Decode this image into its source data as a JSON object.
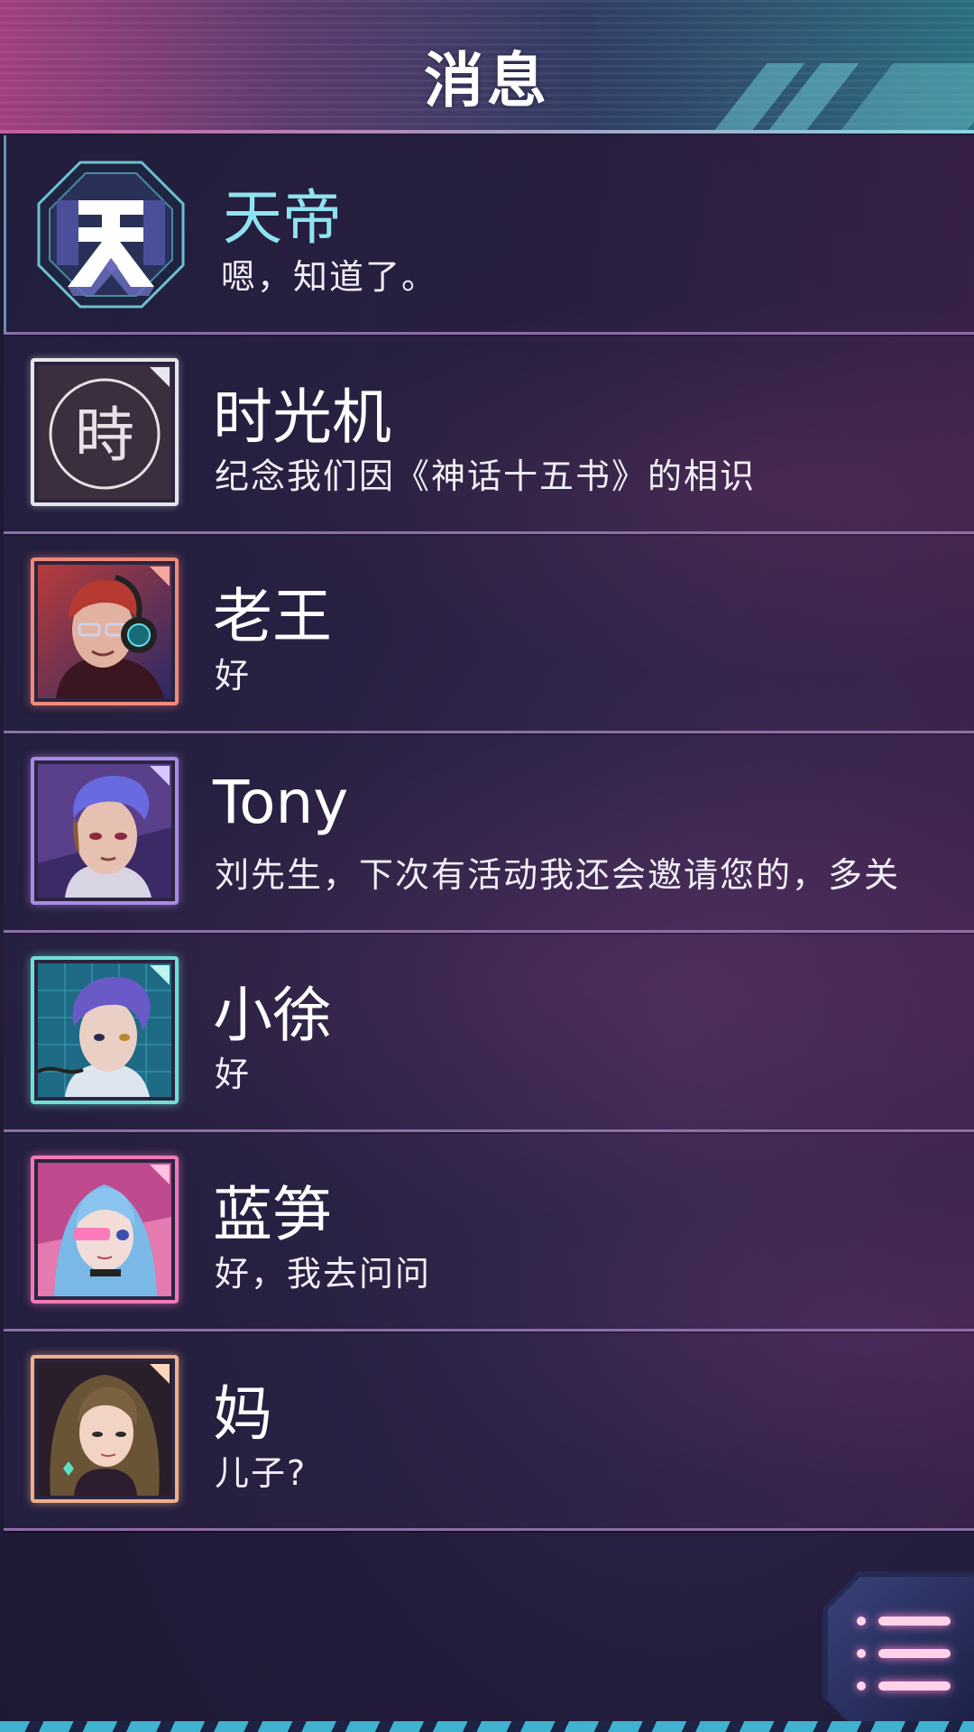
{
  "header": {
    "title": "消息"
  },
  "conversations": [
    {
      "name": "天帝",
      "message": "嗯，知道了。",
      "avatar_icon": "tian-emblem-icon",
      "frame_color": "#6cc1d0",
      "name_color": "#8fe3f0",
      "emblem_char": "天"
    },
    {
      "name": "时光机",
      "message": "纪念我们因《神话十五书》的相识",
      "avatar_icon": "time-machine-seal-icon",
      "frame_color": "#e6e6ea",
      "name_color": "#ffffff",
      "emblem_char": "時"
    },
    {
      "name": "老王",
      "message": "好",
      "avatar_icon": "lao-wang-portrait",
      "frame_color": "#f08a7c",
      "name_color": "#ffffff"
    },
    {
      "name": "Tony",
      "message": "刘先生，下次有活动我还会邀请您的，多关",
      "avatar_icon": "tony-portrait",
      "frame_color": "#a88ae6",
      "name_color": "#ffffff"
    },
    {
      "name": "小徐",
      "message": "好",
      "avatar_icon": "xiao-xu-portrait",
      "frame_color": "#6fe0d6",
      "name_color": "#ffffff"
    },
    {
      "name": "蓝笋",
      "message": "好，我去问问",
      "avatar_icon": "lan-sun-portrait",
      "frame_color": "#f07ab6",
      "name_color": "#ffffff"
    },
    {
      "name": "妈",
      "message": "儿子?",
      "avatar_icon": "mom-portrait",
      "frame_color": "#f0b08a",
      "name_color": "#ffffff"
    }
  ],
  "menu_button": {
    "icon": "menu-list-icon"
  }
}
